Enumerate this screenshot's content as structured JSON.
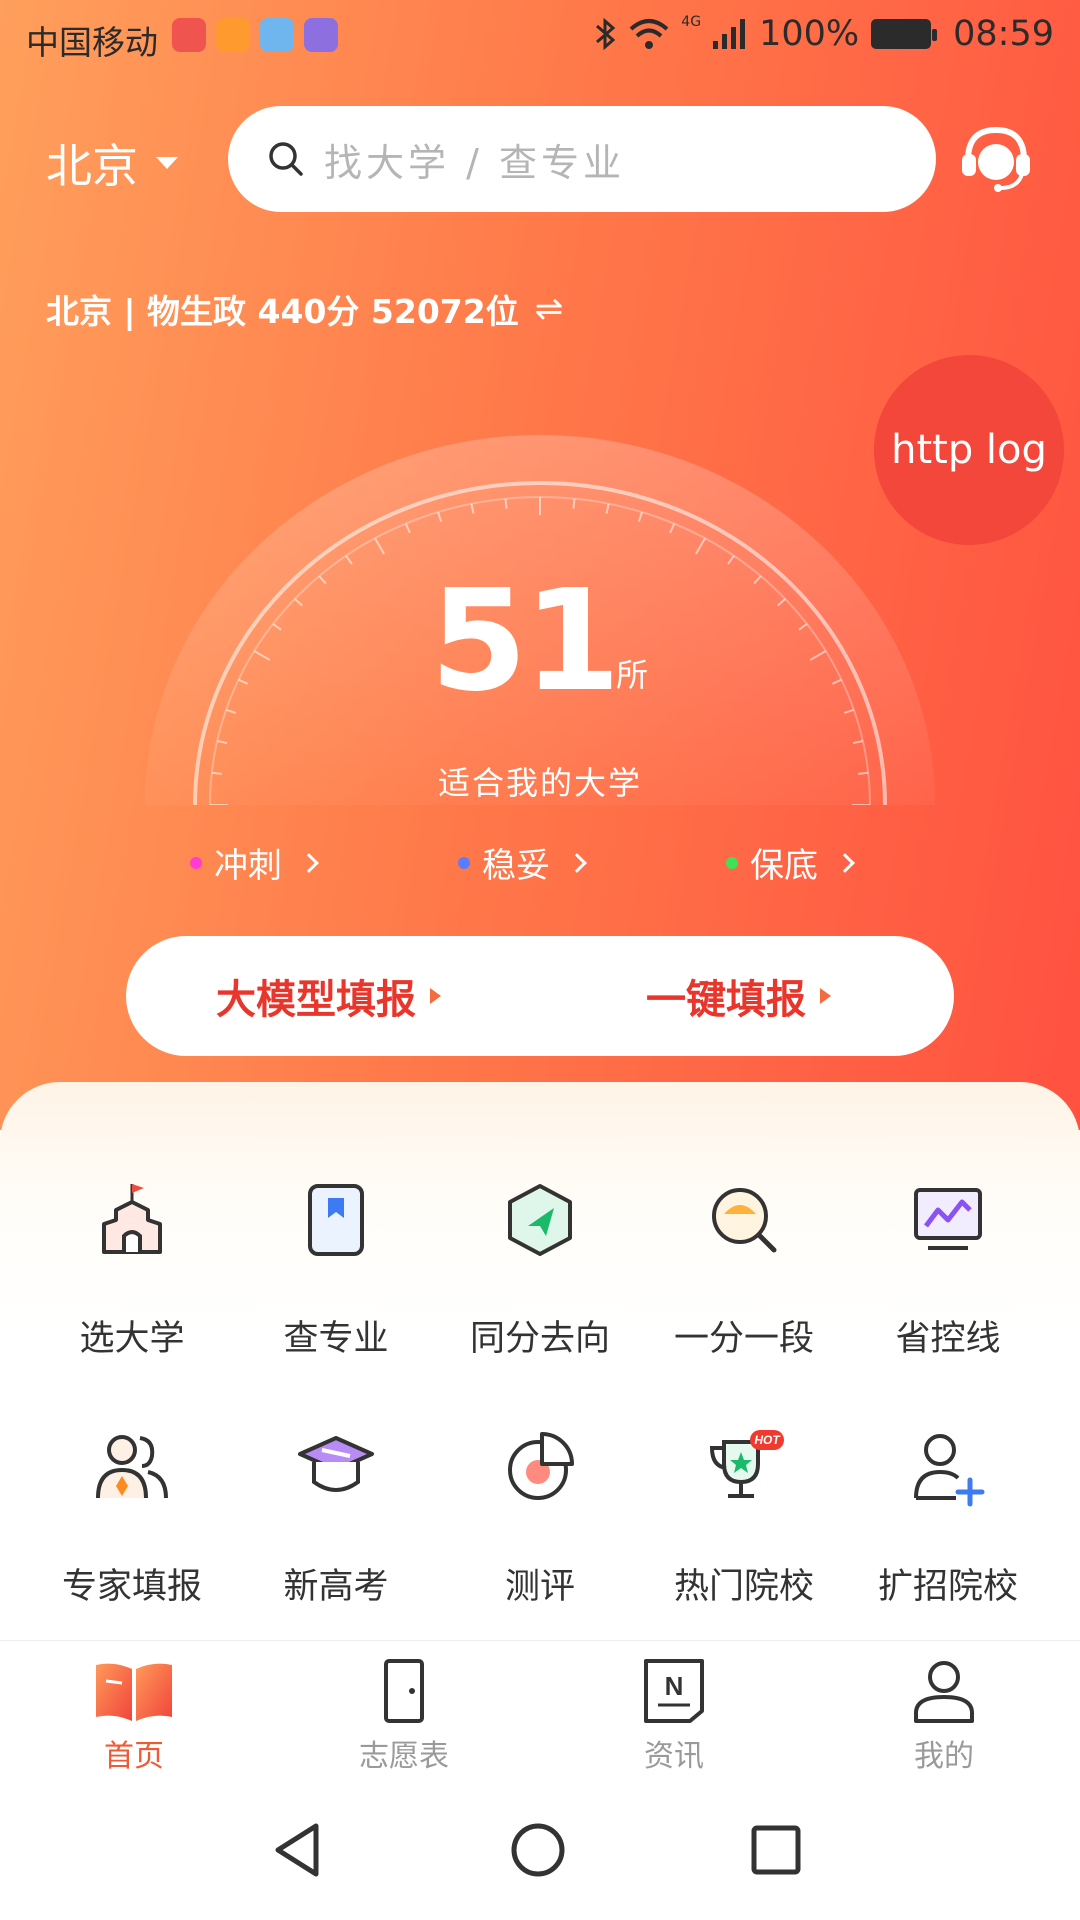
{
  "status_bar": {
    "carrier": "中国移动",
    "battery": "100%",
    "time": "08:59",
    "network": "4G"
  },
  "header": {
    "city": "北京",
    "search_placeholder": "找大学 / 查专业"
  },
  "profile": {
    "summary": "北京 | 物生政 440分 52072位",
    "swap_symbol": "⇌"
  },
  "debug_bubble": "http log",
  "gauge": {
    "count": "51",
    "unit": "所",
    "label": "适合我的大学"
  },
  "tiers": [
    {
      "label": "冲刺",
      "color": "#ff3dd1"
    },
    {
      "label": "稳妥",
      "color": "#5a7cff"
    },
    {
      "label": "保底",
      "color": "#3fe05a"
    }
  ],
  "fill_actions": {
    "ai_fill": "大模型填报",
    "one_click": "一键填报"
  },
  "grid": [
    {
      "label": "选大学",
      "icon": "campus-icon"
    },
    {
      "label": "查专业",
      "icon": "book-icon"
    },
    {
      "label": "同分去向",
      "icon": "direction-icon"
    },
    {
      "label": "一分一段",
      "icon": "magnifier-icon"
    },
    {
      "label": "省控线",
      "icon": "monitor-chart-icon"
    },
    {
      "label": "专家填报",
      "icon": "experts-icon"
    },
    {
      "label": "新高考",
      "icon": "graduation-cap-icon"
    },
    {
      "label": "测评",
      "icon": "pie-icon"
    },
    {
      "label": "热门院校",
      "icon": "trophy-icon",
      "badge": "HOT"
    },
    {
      "label": "扩招院校",
      "icon": "add-user-icon"
    }
  ],
  "tabs": [
    {
      "label": "首页",
      "icon": "book-open-icon",
      "active": true
    },
    {
      "label": "志愿表",
      "icon": "door-icon",
      "active": false
    },
    {
      "label": "资讯",
      "icon": "news-icon",
      "active": false
    },
    {
      "label": "我的",
      "icon": "user-icon",
      "active": false
    }
  ],
  "colors": {
    "accent_red": "#e8362c",
    "hero_gradient_start": "#ff9f5c",
    "hero_gradient_end": "#ff5140",
    "tab_active": "#ef5a36"
  }
}
